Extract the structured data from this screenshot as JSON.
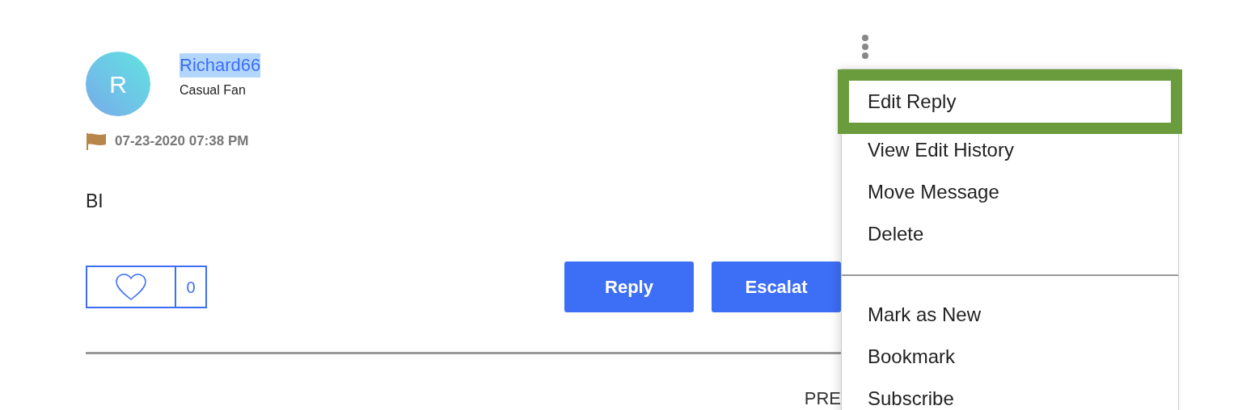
{
  "post": {
    "avatar_letter": "R",
    "author": "Richard66",
    "author_selected": true,
    "rank": "Casual Fan",
    "date": "07-23-2020 07:38 PM",
    "body": "BI",
    "like_count": "0",
    "buttons": [
      "Reply",
      "Escalat"
    ]
  },
  "pager": {
    "label": "PRE"
  },
  "menu": {
    "groups": [
      [
        {
          "label": "Edit Reply",
          "selected": true
        },
        {
          "label": "View Edit History",
          "selected": false
        },
        {
          "label": "Move Message",
          "selected": false
        },
        {
          "label": "Delete",
          "selected": false
        }
      ],
      [
        {
          "label": "Mark as New",
          "selected": false
        },
        {
          "label": "Bookmark",
          "selected": false
        },
        {
          "label": "Subscribe",
          "selected": false
        }
      ]
    ]
  }
}
